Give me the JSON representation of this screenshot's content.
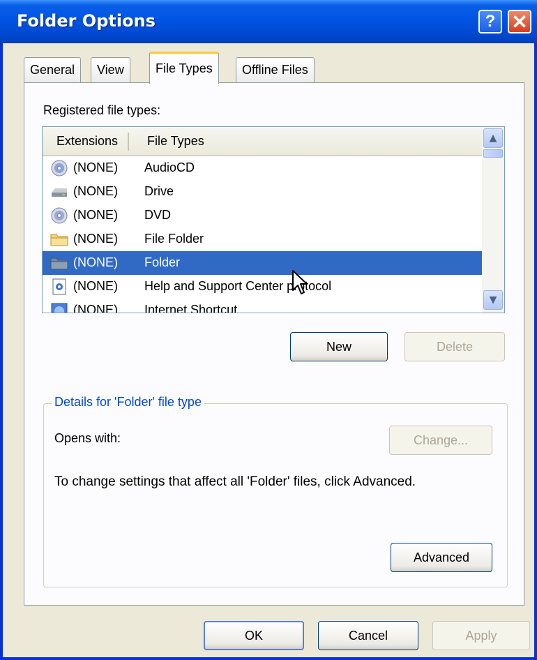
{
  "window": {
    "title": "Folder Options"
  },
  "titlebar": {
    "help_glyph": "?",
    "close_glyph": "✕"
  },
  "tabs": [
    {
      "label": "General",
      "active": false
    },
    {
      "label": "View",
      "active": false
    },
    {
      "label": "File Types",
      "active": true
    },
    {
      "label": "Offline Files",
      "active": false
    }
  ],
  "file_types": {
    "section_label": "Registered file types:",
    "columns": [
      "Extensions",
      "File Types"
    ],
    "rows": [
      {
        "ext": "(NONE)",
        "type": "AudioCD",
        "icon": "cd-icon"
      },
      {
        "ext": "(NONE)",
        "type": "Drive",
        "icon": "drive-icon"
      },
      {
        "ext": "(NONE)",
        "type": "DVD",
        "icon": "dvd-icon"
      },
      {
        "ext": "(NONE)",
        "type": "File Folder",
        "icon": "folder-icon"
      },
      {
        "ext": "(NONE)",
        "type": "Folder",
        "icon": "folder-icon",
        "selected": true
      },
      {
        "ext": "(NONE)",
        "type": "Help and Support Center protocol",
        "icon": "help-document-icon"
      },
      {
        "ext": "(NONE)",
        "type": "Internet Shortcut",
        "icon": "internet-shortcut-icon"
      }
    ],
    "new_label": "New",
    "delete_label": "Delete"
  },
  "details": {
    "group_title": "Details for 'Folder' file type",
    "opens_with_label": "Opens with:",
    "change_label": "Change...",
    "description": "To change settings that affect all 'Folder' files, click Advanced.",
    "advanced_label": "Advanced"
  },
  "footer": {
    "ok_label": "OK",
    "cancel_label": "Cancel",
    "apply_label": "Apply"
  },
  "colors": {
    "title_bar": "#0054e3",
    "selection": "#316ac5",
    "tab_highlight": "#ffc83c",
    "dialog_bg": "#ece9d8"
  }
}
